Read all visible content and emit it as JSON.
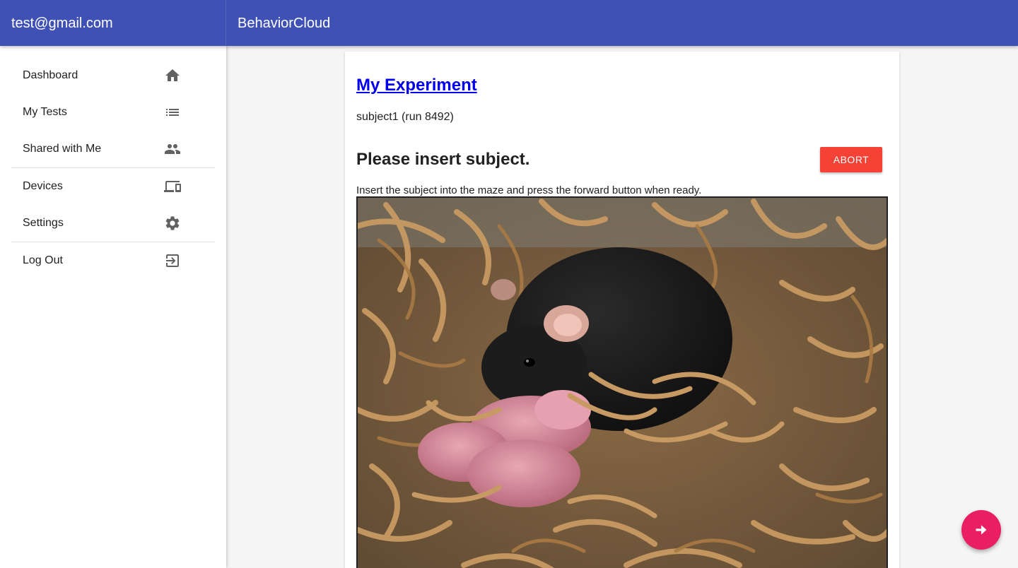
{
  "header": {
    "account_email": "test@gmail.com",
    "app_title": "BehaviorCloud"
  },
  "sidebar": {
    "items": [
      {
        "label": "Dashboard",
        "icon": "home-icon"
      },
      {
        "label": "My Tests",
        "icon": "list-icon"
      },
      {
        "label": "Shared with Me",
        "icon": "people-icon"
      },
      {
        "label": "Devices",
        "icon": "devices-icon"
      },
      {
        "label": "Settings",
        "icon": "gear-icon"
      },
      {
        "label": "Log Out",
        "icon": "logout-icon"
      }
    ]
  },
  "main": {
    "experiment_link": "My Experiment",
    "subject_line": "subject1 (run 8492)",
    "prompt_title": "Please insert subject.",
    "abort_label": "ABORT",
    "instruction": "Insert the subject into the maze and press the forward button when ready.",
    "photo_icon": "mouse-nest-photo",
    "fab_icon": "forward-arrow-icon"
  },
  "colors": {
    "app_bar": "#3f51b5",
    "abort": "#f44336",
    "fab": "#e91e63",
    "link": "#0000ee"
  }
}
